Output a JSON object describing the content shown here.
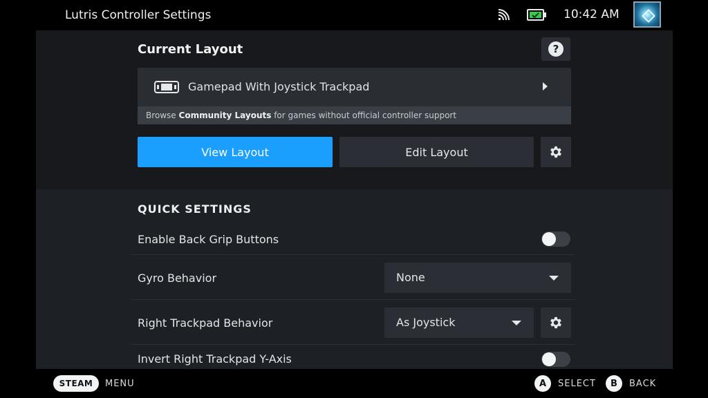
{
  "topbar": {
    "title": "Lutris Controller Settings",
    "time": "10:42 AM",
    "network_icon": "wifi-signal-icon",
    "battery_icon": "battery-charging-icon",
    "avatar_icon": "user-avatar-icon"
  },
  "current_layout": {
    "heading": "Current Layout",
    "help_label": "?",
    "layout_name": "Gamepad With Joystick Trackpad",
    "browse_prefix": "Browse ",
    "browse_bold": "Community Layouts",
    "browse_suffix": " for games without official controller support",
    "view_button": "View Layout",
    "edit_button": "Edit Layout"
  },
  "quick_settings": {
    "heading": "QUICK SETTINGS",
    "back_grip": {
      "label": "Enable Back Grip Buttons",
      "enabled": false
    },
    "gyro": {
      "label": "Gyro Behavior",
      "value": "None"
    },
    "right_trackpad": {
      "label": "Right Trackpad Behavior",
      "value": "As Joystick"
    },
    "invert_y": {
      "label": "Invert Right Trackpad Y-Axis",
      "enabled": false
    }
  },
  "bottombar": {
    "steam_label": "STEAM",
    "menu_label": "MENU",
    "a_label": "A",
    "select_label": "SELECT",
    "b_label": "B",
    "back_label": "BACK"
  },
  "colors": {
    "accent": "#1a9fff",
    "panel": "#1d2024",
    "button": "#2b2f35"
  }
}
